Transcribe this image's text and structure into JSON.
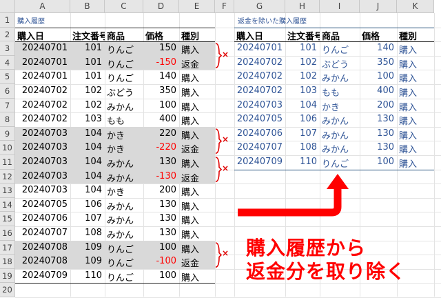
{
  "columns": [
    "A",
    "B",
    "C",
    "D",
    "E",
    "F",
    "G",
    "H",
    "I",
    "J",
    "K"
  ],
  "rows": [
    "1",
    "2",
    "3",
    "4",
    "5",
    "6",
    "7",
    "8",
    "9",
    "10",
    "11",
    "12",
    "13",
    "14",
    "15",
    "16",
    "17",
    "18",
    "19",
    "20"
  ],
  "left_title": "購入履歴",
  "right_title": "返金を除いた購入履歴",
  "headers": [
    "購入日",
    "注文番号",
    "商品",
    "価格",
    "種別"
  ],
  "left_table": [
    [
      "20240701",
      "101",
      "りんご",
      "150",
      "購入"
    ],
    [
      "20240701",
      "101",
      "りんご",
      "-150",
      "返金"
    ],
    [
      "20240701",
      "101",
      "りんご",
      "140",
      "購入"
    ],
    [
      "20240702",
      "102",
      "ぶどう",
      "350",
      "購入"
    ],
    [
      "20240702",
      "102",
      "みかん",
      "100",
      "購入"
    ],
    [
      "20240702",
      "103",
      "もも",
      "400",
      "購入"
    ],
    [
      "20240703",
      "104",
      "かき",
      "220",
      "購入"
    ],
    [
      "20240703",
      "104",
      "かき",
      "-220",
      "返金"
    ],
    [
      "20240703",
      "104",
      "みかん",
      "130",
      "購入"
    ],
    [
      "20240703",
      "104",
      "みかん",
      "-130",
      "返金"
    ],
    [
      "20240703",
      "104",
      "かき",
      "200",
      "購入"
    ],
    [
      "20240705",
      "106",
      "みかん",
      "130",
      "購入"
    ],
    [
      "20240706",
      "107",
      "みかん",
      "130",
      "購入"
    ],
    [
      "20240707",
      "108",
      "みかん",
      "130",
      "購入"
    ],
    [
      "20240708",
      "109",
      "りんご",
      "100",
      "購入"
    ],
    [
      "20240708",
      "109",
      "りんご",
      "-100",
      "返金"
    ],
    [
      "20240709",
      "110",
      "りんご",
      "100",
      "購入"
    ]
  ],
  "right_table": [
    [
      "20240701",
      "101",
      "りんご",
      "140",
      "購入"
    ],
    [
      "20240702",
      "102",
      "ぶどう",
      "350",
      "購入"
    ],
    [
      "20240702",
      "102",
      "みかん",
      "100",
      "購入"
    ],
    [
      "20240702",
      "103",
      "もも",
      "400",
      "購入"
    ],
    [
      "20240703",
      "104",
      "かき",
      "200",
      "購入"
    ],
    [
      "20240705",
      "106",
      "みかん",
      "130",
      "購入"
    ],
    [
      "20240706",
      "107",
      "みかん",
      "130",
      "購入"
    ],
    [
      "20240707",
      "108",
      "みかん",
      "130",
      "購入"
    ],
    [
      "20240709",
      "110",
      "りんご",
      "100",
      "購入"
    ]
  ],
  "x_mark": "×",
  "caption_line1": "購入履歴から",
  "caption_line2": "返金分を取り除く",
  "colors": {
    "highlight": "#d9d9d9",
    "refund_text": "#ff0000",
    "right_text": "#2f5496",
    "arrow": "#ff0000"
  }
}
